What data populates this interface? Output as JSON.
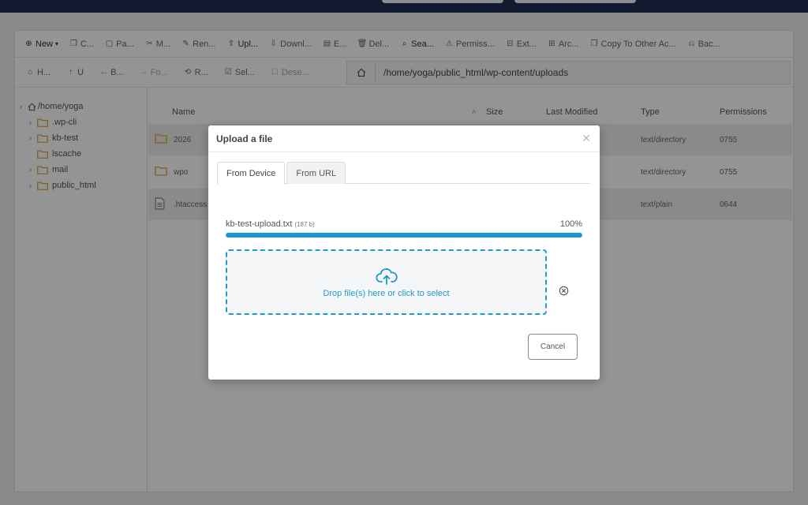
{
  "toolbar": {
    "items": [
      {
        "icon": "plus-circle-icon",
        "label": "New",
        "dropdown": true
      },
      {
        "icon": "copy-icon",
        "label": "C..."
      },
      {
        "icon": "paste-icon",
        "label": "Pa..."
      },
      {
        "icon": "scissors-icon",
        "label": "M..."
      },
      {
        "icon": "pencil-icon",
        "label": "Ren..."
      },
      {
        "icon": "upload-icon",
        "label": "Upl..."
      },
      {
        "icon": "download-icon",
        "label": "Downl..."
      },
      {
        "icon": "edit-icon",
        "label": "E..."
      },
      {
        "icon": "trash-icon",
        "label": "Del..."
      },
      {
        "icon": "search-icon",
        "label": "Sea..."
      },
      {
        "icon": "key-icon",
        "label": "Permiss..."
      },
      {
        "icon": "extract-icon",
        "label": "Ext..."
      },
      {
        "icon": "archive-icon",
        "label": "Arc..."
      },
      {
        "icon": "copy-account-icon",
        "label": "Copy To Other Ac..."
      },
      {
        "icon": "backup-icon",
        "label": "Bac..."
      }
    ],
    "nav": [
      {
        "icon": "home-icon",
        "label": "H..."
      },
      {
        "icon": "arrow-up-icon",
        "label": "U"
      },
      {
        "icon": "arrow-left-icon",
        "label": "B..."
      },
      {
        "icon": "arrow-right-icon",
        "label": "Fo..."
      },
      {
        "icon": "refresh-icon",
        "label": "R..."
      },
      {
        "icon": "check-square-icon",
        "label": "Sel..."
      },
      {
        "icon": "square-icon",
        "label": "Dese..."
      }
    ],
    "path": "/home/yoga/public_html/wp-content/uploads"
  },
  "tree": {
    "root": "/home/yoga",
    "items": [
      {
        "label": ".wp-cli",
        "expandable": true
      },
      {
        "label": "kb-test",
        "expandable": true
      },
      {
        "label": "lscache",
        "expandable": false
      },
      {
        "label": "mail",
        "expandable": true
      },
      {
        "label": "public_html",
        "expandable": true
      }
    ]
  },
  "table": {
    "headers": {
      "name": "Name",
      "size": "Size",
      "modified": "Last Modified",
      "type": "Type",
      "permissions": "Permissions"
    },
    "rows": [
      {
        "name": "2026",
        "type": "text/directory",
        "permissions": "0755",
        "icon": "folder-icon"
      },
      {
        "name": "wpo",
        "type": "text/directory",
        "permissions": "0755",
        "icon": "folder-icon"
      },
      {
        "name": ".htaccess",
        "type": "text/plain",
        "permissions": "0644",
        "icon": "file-icon"
      }
    ]
  },
  "modal": {
    "title": "Upload a file",
    "tabs": [
      {
        "label": "From Device",
        "active": true
      },
      {
        "label": "From URL",
        "active": false
      }
    ],
    "file_name": "kb-test-upload.txt",
    "file_size": "(187 b)",
    "progress_text": "100%",
    "progress": 1.0,
    "drop_text": "Drop file(s) here or click to select",
    "cancel_label": "Cancel"
  },
  "colors": {
    "accent": "#1a97d5",
    "folder": "#e0a030",
    "topbar": "#1e2c52"
  }
}
